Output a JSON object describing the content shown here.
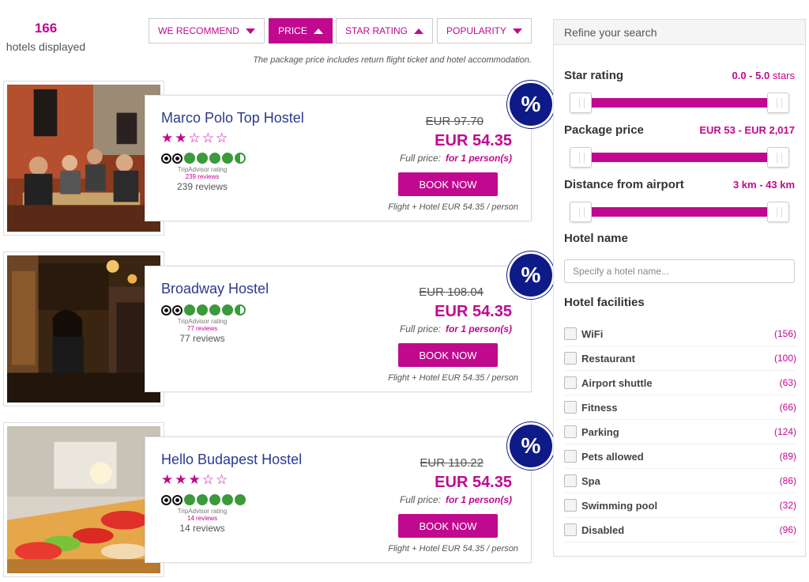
{
  "results": {
    "count": "166",
    "count_label": "hotels displayed"
  },
  "sort": [
    {
      "label": "WE RECOMMEND",
      "direction": "down",
      "active": false
    },
    {
      "label": "PRICE",
      "direction": "up",
      "active": true
    },
    {
      "label": "STAR RATING",
      "direction": "up",
      "active": false
    },
    {
      "label": "POPULARITY",
      "direction": "down",
      "active": false
    }
  ],
  "note": "The package price includes return flight ticket and hotel accommodation.",
  "hotels": [
    {
      "name": "Marco Polo Top Hostel",
      "stars": "★★☆☆☆",
      "ta_caption": "TripAdvisor rating",
      "ta_small": "239 reviews",
      "reviews": "239 reviews",
      "ta_bubbles": 4.5,
      "old_price": "EUR 97.70",
      "new_price": "EUR 54.35",
      "full_price_label": "Full price:",
      "full_price_value": "for 1 person(s)",
      "book": "BOOK NOW",
      "flight": "Flight + Hotel EUR 54.35 / person",
      "badge": "%"
    },
    {
      "name": "Broadway Hostel",
      "stars": "",
      "ta_caption": "TripAdvisor rating",
      "ta_small": "77 reviews",
      "reviews": "77 reviews",
      "ta_bubbles": 4.5,
      "old_price": "EUR 108.04",
      "new_price": "EUR 54.35",
      "full_price_label": "Full price:",
      "full_price_value": "for 1 person(s)",
      "book": "BOOK NOW",
      "flight": "Flight + Hotel EUR 54.35 / person",
      "badge": "%"
    },
    {
      "name": "Hello Budapest Hostel",
      "stars": "★★★☆☆",
      "ta_caption": "TripAdvisor rating",
      "ta_small": "14 reviews",
      "reviews": "14 reviews",
      "ta_bubbles": 5,
      "old_price": "EUR 110.22",
      "new_price": "EUR 54.35",
      "full_price_label": "Full price:",
      "full_price_value": "for 1 person(s)",
      "book": "BOOK NOW",
      "flight": "Flight + Hotel EUR 54.35 / person",
      "badge": "%"
    }
  ],
  "refine": {
    "title": "Refine your search",
    "star_label": "Star rating",
    "star_value": "0.0 - 5.0",
    "star_unit": "stars",
    "price_label": "Package price",
    "price_value": "EUR 53 - EUR 2,017",
    "distance_label": "Distance from airport",
    "distance_value": "3 km - 43 km",
    "hotel_name_label": "Hotel name",
    "hotel_name_placeholder": "Specify a hotel name...",
    "facilities_label": "Hotel facilities",
    "facilities": [
      {
        "label": "WiFi",
        "count": "(156)"
      },
      {
        "label": "Restaurant",
        "count": "(100)"
      },
      {
        "label": "Airport shuttle",
        "count": "(63)"
      },
      {
        "label": "Fitness",
        "count": "(66)"
      },
      {
        "label": "Parking",
        "count": "(124)"
      },
      {
        "label": "Pets allowed",
        "count": "(89)"
      },
      {
        "label": "Spa",
        "count": "(86)"
      },
      {
        "label": "Swimming pool",
        "count": "(32)"
      },
      {
        "label": "Disabled",
        "count": "(96)"
      }
    ]
  },
  "colors": {
    "accent": "#c0098f",
    "badge": "#0d1a87",
    "hotel_name": "#2b3a8f"
  },
  "icons": {
    "sort_down": "triangle-down-icon",
    "sort_up": "triangle-up-icon",
    "badge": "percent-badge-icon",
    "tripadvisor": "tripadvisor-owl-icon"
  }
}
